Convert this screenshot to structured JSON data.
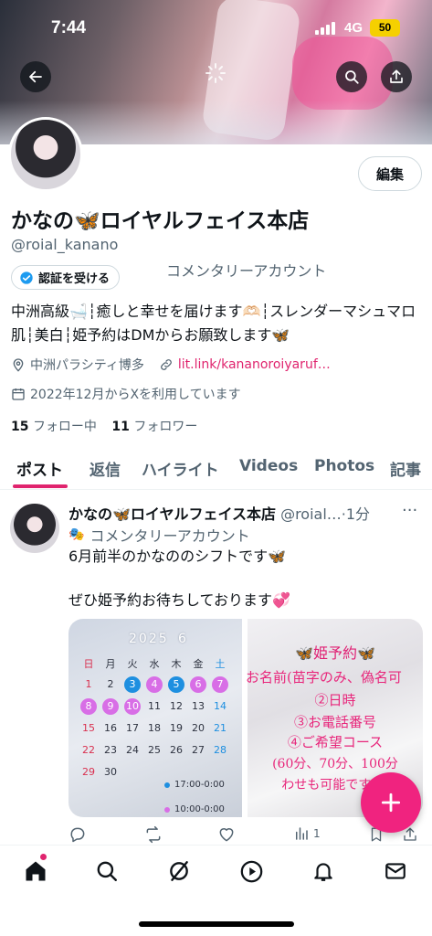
{
  "status_bar": {
    "time": "7:44",
    "network": "4G",
    "battery": "50"
  },
  "banner": {
    "back_icon": "arrow-left-icon",
    "search_icon": "search-icon",
    "share_icon": "share-icon"
  },
  "profile": {
    "edit_label": "編集",
    "name": "かなの🦋ロイヤルフェイス本店",
    "handle": "@roial_kanano",
    "commentary": "コメンタリーアカウント",
    "verify_label": "認証を受ける",
    "bio": "中洲高級🛁┆癒しと幸せを届けます🫶🏻┆スレンダーマシュマロ肌┆美白┆姫予約はDMからお願致します🦋",
    "location": "中洲パラシティ博多",
    "link": "lit.link/kananoroiyaruf…",
    "joined": "2022年12月からXを利用しています",
    "following_count": "15",
    "following_label": "フォロー中",
    "followers_count": "11",
    "followers_label": "フォロワー"
  },
  "tabs": [
    "ポスト",
    "返信",
    "ハイライト",
    "Videos",
    "Photos",
    "記事"
  ],
  "post": {
    "author": "かなの🦋ロイヤルフェイス本店",
    "meta": "@roial…·1分",
    "commentary": "コメンタリーアカウント",
    "text_line1": "6月前半のかなののシフトです🦋",
    "text_line2": "ぜひ姫予約お待ちしております💞",
    "calendar": {
      "year": "2025",
      "month": "6",
      "weekdays": [
        "日",
        "月",
        "火",
        "水",
        "木",
        "金",
        "土"
      ],
      "legend1": "17:00-0:00",
      "legend2": "10:00-0:00"
    },
    "reserve_lines": [
      "🦋姫予約🦋",
      "お名前(苗字のみ、偽名可",
      "②日時",
      "③お電話番号",
      "④ご希望コース",
      "(60分、70分、100分",
      "わせも可能です(例"
    ],
    "actions": {
      "reply_count": "",
      "repost_count": "",
      "like_count": "",
      "views_count": "1"
    }
  }
}
